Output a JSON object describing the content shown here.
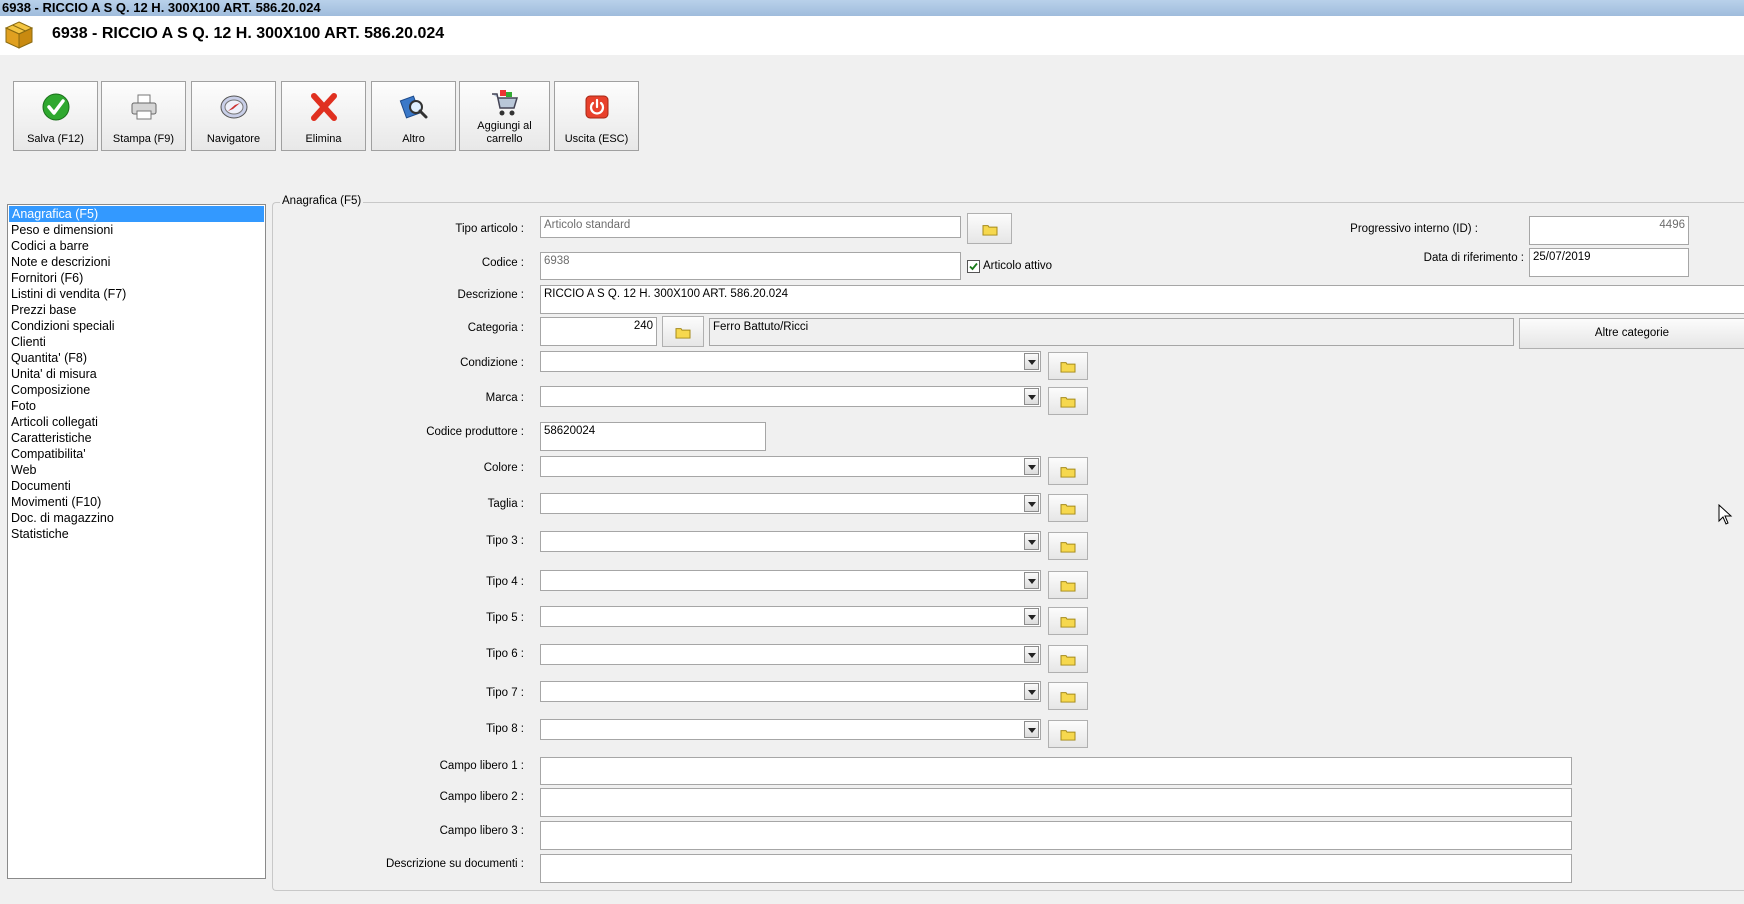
{
  "window": {
    "title": "6938 - RICCIO A S Q. 12 H. 300X100 ART. 586.20.024",
    "header_title": "6938 - RICCIO A S Q. 12 H. 300X100 ART. 586.20.024"
  },
  "toolbar": {
    "save": "Salva (F12)",
    "print": "Stampa (F9)",
    "navigator": "Navigatore",
    "delete": "Elimina",
    "other": "Altro",
    "cart_line1": "Aggiungi al",
    "cart_line2": "carrello",
    "exit": "Uscita (ESC)"
  },
  "nav": {
    "items": [
      "Anagrafica (F5)",
      "Peso e dimensioni",
      "Codici a barre",
      "Note e descrizioni",
      "Fornitori (F6)",
      "Listini di vendita (F7)",
      "Prezzi base",
      "Condizioni speciali",
      "Clienti",
      "Quantita' (F8)",
      "Unita' di misura",
      "Composizione",
      "Foto",
      "Articoli collegati",
      "Caratteristiche",
      "Compatibilita'",
      "Web",
      "Documenti",
      "Movimenti (F10)",
      "Doc. di magazzino",
      "Statistiche"
    ],
    "selected_index": 0
  },
  "form": {
    "group_title": "Anagrafica (F5)",
    "labels": {
      "tipo_articolo": "Tipo articolo :",
      "codice": "Codice :",
      "descrizione": "Descrizione :",
      "categoria": "Categoria :",
      "condizione": "Condizione :",
      "marca": "Marca :",
      "codice_produttore": "Codice produttore :",
      "colore": "Colore :",
      "taglia": "Taglia :",
      "tipo3": "Tipo 3 :",
      "tipo4": "Tipo 4 :",
      "tipo5": "Tipo 5 :",
      "tipo6": "Tipo 6 :",
      "tipo7": "Tipo 7 :",
      "tipo8": "Tipo 8 :",
      "campo1": "Campo libero 1 :",
      "campo2": "Campo libero 2 :",
      "campo3": "Campo libero 3 :",
      "desc_documenti": "Descrizione su documenti :",
      "progressivo": "Progressivo interno (ID) :",
      "data_riferimento": "Data di riferimento :"
    },
    "values": {
      "tipo_articolo": "Articolo standard",
      "codice": "6938",
      "descrizione": "RICCIO A S Q. 12 H. 300X100 ART. 586.20.024",
      "categoria_code": "240",
      "categoria_name": "Ferro Battuto/Ricci",
      "codice_produttore": "58620024",
      "progressivo": "4496",
      "data_riferimento": "25/07/2019"
    },
    "articolo_attivo": {
      "label": "Articolo attivo",
      "checked": true
    },
    "altre_categorie": "Altre categorie"
  },
  "colors": {
    "selection": "#3399ff",
    "titlebar": "#b9d1ea",
    "background": "#f0f0f0"
  },
  "icons": {
    "save": "check-icon",
    "print": "printer-icon",
    "navigator": "compass-icon",
    "delete": "x-icon",
    "other": "magnifier-icon",
    "cart": "cart-icon",
    "exit": "power-icon",
    "lookup": "folder-icon"
  }
}
